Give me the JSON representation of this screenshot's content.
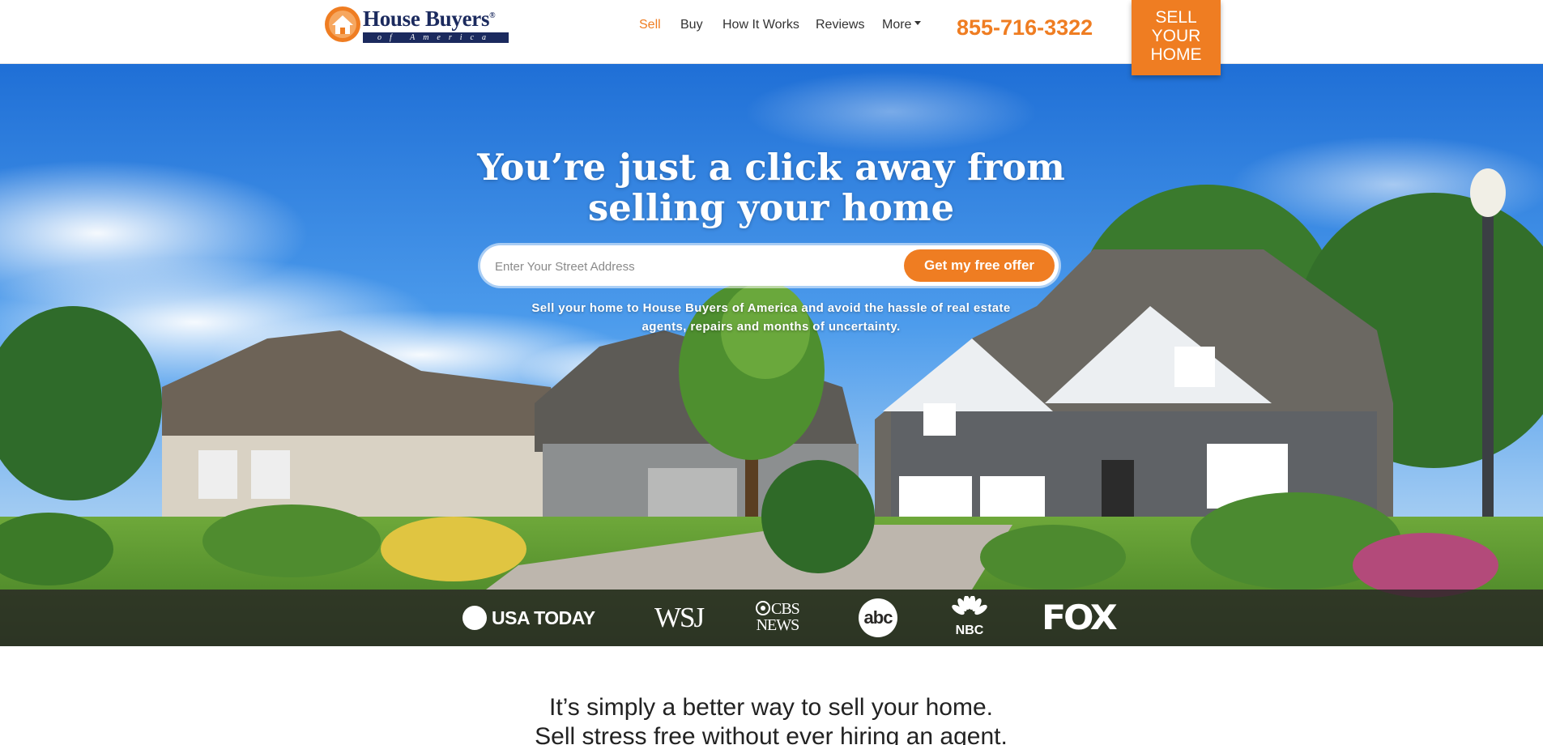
{
  "header": {
    "logo": {
      "name": "House Buyers",
      "registered": "®",
      "sub": "of America"
    },
    "nav": [
      {
        "label": "Sell",
        "active": true
      },
      {
        "label": "Buy",
        "active": false
      },
      {
        "label": "How It Works",
        "active": false
      },
      {
        "label": "Reviews",
        "active": false
      },
      {
        "label": "More",
        "active": false,
        "dropdown": true
      }
    ],
    "phone": "855-716-3322",
    "cta": {
      "line1": "SELL",
      "line2": "YOUR",
      "line3": "HOME"
    }
  },
  "hero": {
    "title_line1": "You’re just a click away from",
    "title_line2": "selling your home",
    "search": {
      "placeholder": "Enter Your Street Address",
      "value": ""
    },
    "offer_button": "Get my free offer",
    "subtitle_line1": "Sell your home to House Buyers of America and avoid the hassle of real estate",
    "subtitle_line2": "agents, repairs and months of uncertainty."
  },
  "media_logos": {
    "usa_today": "USA TODAY",
    "wsj": "WSJ",
    "cbs_line1": "CBS",
    "cbs_line2": "NEWS",
    "abc": "abc",
    "nbc": "NBC",
    "fox": "FOX"
  },
  "tagline": {
    "line1": "It’s simply a better way to sell your home.",
    "line2": "Sell stress free without ever hiring an agent."
  },
  "colors": {
    "accent": "#ef7d22",
    "brand_navy": "#1b2a5e",
    "text": "#333333"
  }
}
